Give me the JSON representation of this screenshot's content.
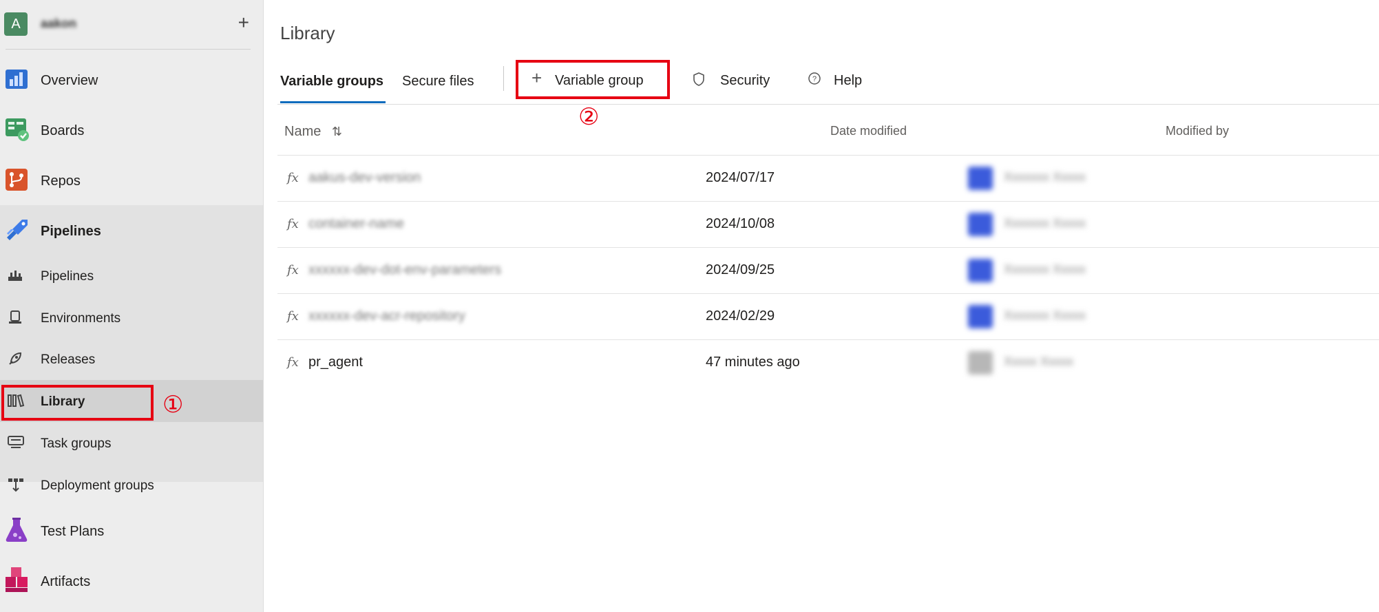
{
  "project": {
    "avatar_letter": "A",
    "name": "aakon",
    "add_label": "+"
  },
  "sidebar": {
    "items": [
      {
        "label": "Overview"
      },
      {
        "label": "Boards"
      },
      {
        "label": "Repos"
      },
      {
        "label": "Pipelines"
      },
      {
        "label": "Pipelines"
      },
      {
        "label": "Environments"
      },
      {
        "label": "Releases"
      },
      {
        "label": "Library"
      },
      {
        "label": "Task groups"
      },
      {
        "label": "Deployment groups"
      },
      {
        "label": "Test Plans"
      },
      {
        "label": "Artifacts"
      }
    ]
  },
  "main": {
    "title": "Library",
    "tabs": [
      {
        "label": "Variable groups"
      },
      {
        "label": "Secure files"
      }
    ],
    "toolbar": {
      "add_icon": "+",
      "add_label": "Variable group",
      "security_label": "Security",
      "help_label": "Help"
    },
    "table": {
      "headers": {
        "name": "Name",
        "sort_icon": "⇅",
        "date": "Date modified",
        "modified_by": "Modified by"
      },
      "rows": [
        {
          "icon": "fx",
          "name": "aakus-dev-version",
          "date": "2024/07/17",
          "user": "Xxxxxxx Xxxxx"
        },
        {
          "icon": "fx",
          "name": "container-name",
          "date": "2024/10/08",
          "user": "Xxxxxxx Xxxxx"
        },
        {
          "icon": "fx",
          "name": "xxxxxx-dev-dot-env-parameters",
          "date": "2024/09/25",
          "user": "Xxxxxxx Xxxxx"
        },
        {
          "icon": "fx",
          "name": "xxxxxx-dev-acr-repository",
          "date": "2024/02/29",
          "user": "Xxxxxxx Xxxxx"
        },
        {
          "icon": "fx",
          "name": "pr_agent",
          "date": "47 minutes ago",
          "user": "Xxxxx Xxxxx"
        }
      ]
    }
  },
  "annotations": {
    "one": "①",
    "two": "②"
  },
  "colors": {
    "accent": "#0f6cbd",
    "callout": "#e60012",
    "sidebar_bg": "#ededed"
  }
}
